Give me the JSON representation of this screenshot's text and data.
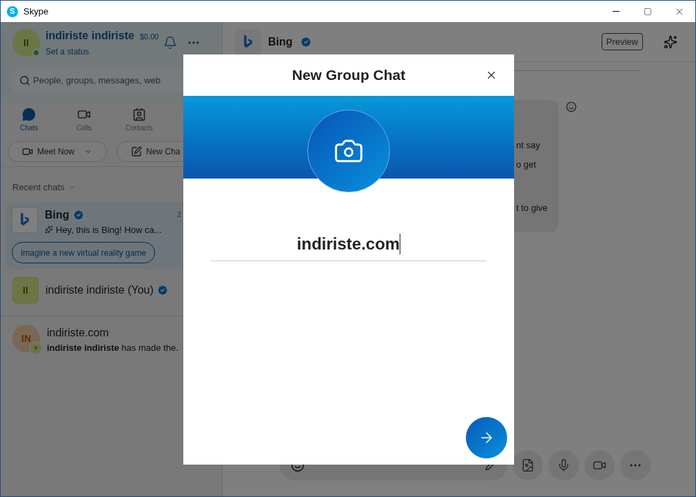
{
  "window": {
    "title": "Skype",
    "logo_letter": "S"
  },
  "profile": {
    "initials": "II",
    "name": "indiriste indiriste",
    "balance": "$0.00",
    "status_link": "Set a status",
    "online": true
  },
  "search": {
    "placeholder": "People, groups, messages, web"
  },
  "tabs": [
    {
      "label": "Chats",
      "kind": "chats",
      "selected": true
    },
    {
      "label": "Calls",
      "kind": "calls",
      "selected": false
    },
    {
      "label": "Contacts",
      "kind": "contacts",
      "selected": false
    }
  ],
  "actions": [
    {
      "label": "Meet Now",
      "kind": "meet"
    },
    {
      "label": "New Cha",
      "kind": "new"
    }
  ],
  "recent_label": "Recent chats",
  "chats": [
    {
      "kind": "bot",
      "name": "Bing",
      "verified": true,
      "time": "2",
      "preview": "Hey, this is Bing! How ca...",
      "suggestion": "Imagine a new virtual reality game",
      "selected": true
    },
    {
      "kind": "self",
      "initials": "II",
      "name": "indiriste indiriste (You)",
      "verified": true,
      "selected": false
    },
    {
      "kind": "group",
      "initials": "IN",
      "badge_initials": "II",
      "name": "indiriste.com",
      "preview": "**indiriste indiriste** has made the.",
      "selected": false
    }
  ],
  "conversation": {
    "name": "Bing",
    "verified": true,
    "preview_button": "Preview",
    "message_lines": [
      "nt say",
      "o get",
      "t to give"
    ]
  },
  "dialog": {
    "title": "New Group Chat",
    "group_name": "indiriste.com"
  }
}
